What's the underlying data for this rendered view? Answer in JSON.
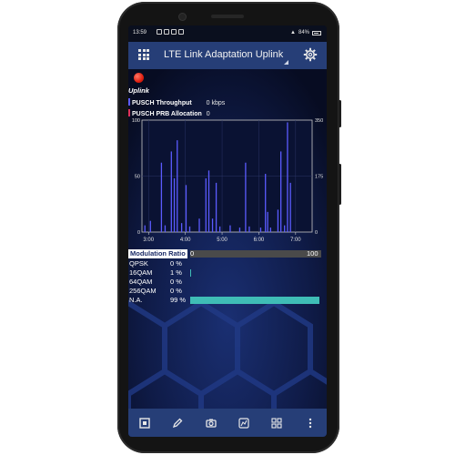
{
  "status_bar": {
    "time": "13:59",
    "battery": "84%"
  },
  "header": {
    "title": "LTE Link Adaptation Uplink"
  },
  "section_title": "Uplink",
  "legend": [
    {
      "label": "PUSCH Throughput",
      "value": "0 kbps",
      "color": "#5b5bff"
    },
    {
      "label": "PUSCH PRB Allocation",
      "value": "0",
      "color": "#e0305a"
    }
  ],
  "chart_data": {
    "type": "bar",
    "left_axis": {
      "ticks": [
        "100",
        "50",
        "0"
      ],
      "ylim": [
        0,
        100
      ]
    },
    "right_axis": {
      "ticks": [
        "350",
        "175",
        "0"
      ],
      "ylim": [
        0,
        350
      ]
    },
    "x_ticks": [
      "3:00",
      "4:00",
      "5:00",
      "6:00",
      "7:00"
    ],
    "series": [
      {
        "color": "#5b5bff",
        "values": [
          [
            2.9,
            6
          ],
          [
            3.05,
            10
          ],
          [
            3.35,
            62
          ],
          [
            3.45,
            6
          ],
          [
            3.62,
            72
          ],
          [
            3.7,
            48
          ],
          [
            3.78,
            82
          ],
          [
            3.9,
            8
          ],
          [
            4.02,
            42
          ],
          [
            4.12,
            5
          ],
          [
            4.38,
            12
          ],
          [
            4.56,
            48
          ],
          [
            4.64,
            55
          ],
          [
            4.74,
            12
          ],
          [
            4.84,
            44
          ],
          [
            4.94,
            5
          ],
          [
            5.22,
            6
          ],
          [
            5.48,
            4
          ],
          [
            5.64,
            62
          ],
          [
            5.74,
            5
          ],
          [
            6.05,
            4
          ],
          [
            6.18,
            52
          ],
          [
            6.24,
            18
          ],
          [
            6.32,
            4
          ],
          [
            6.52,
            20
          ],
          [
            6.6,
            72
          ],
          [
            6.7,
            6
          ],
          [
            6.78,
            98
          ],
          [
            6.86,
            44
          ]
        ]
      }
    ],
    "x_range": [
      2.82,
      7.45
    ]
  },
  "modulation": {
    "title": "Modulation Ratio",
    "scale_min": "0",
    "scale_max": "100",
    "rows": [
      {
        "label": "QPSK",
        "pct": "0 %",
        "value": 0
      },
      {
        "label": "16QAM",
        "pct": "1 %",
        "value": 1
      },
      {
        "label": "64QAM",
        "pct": "0 %",
        "value": 0
      },
      {
        "label": "256QAM",
        "pct": "0 %",
        "value": 0
      },
      {
        "label": "N.A.",
        "pct": "99 %",
        "value": 99
      }
    ],
    "bar_color": "#3fbdb6"
  },
  "bottom_bar": {
    "buttons": [
      "stop-icon",
      "edit-icon",
      "camera-icon",
      "map-icon",
      "grid-icon",
      "more-icon"
    ]
  }
}
